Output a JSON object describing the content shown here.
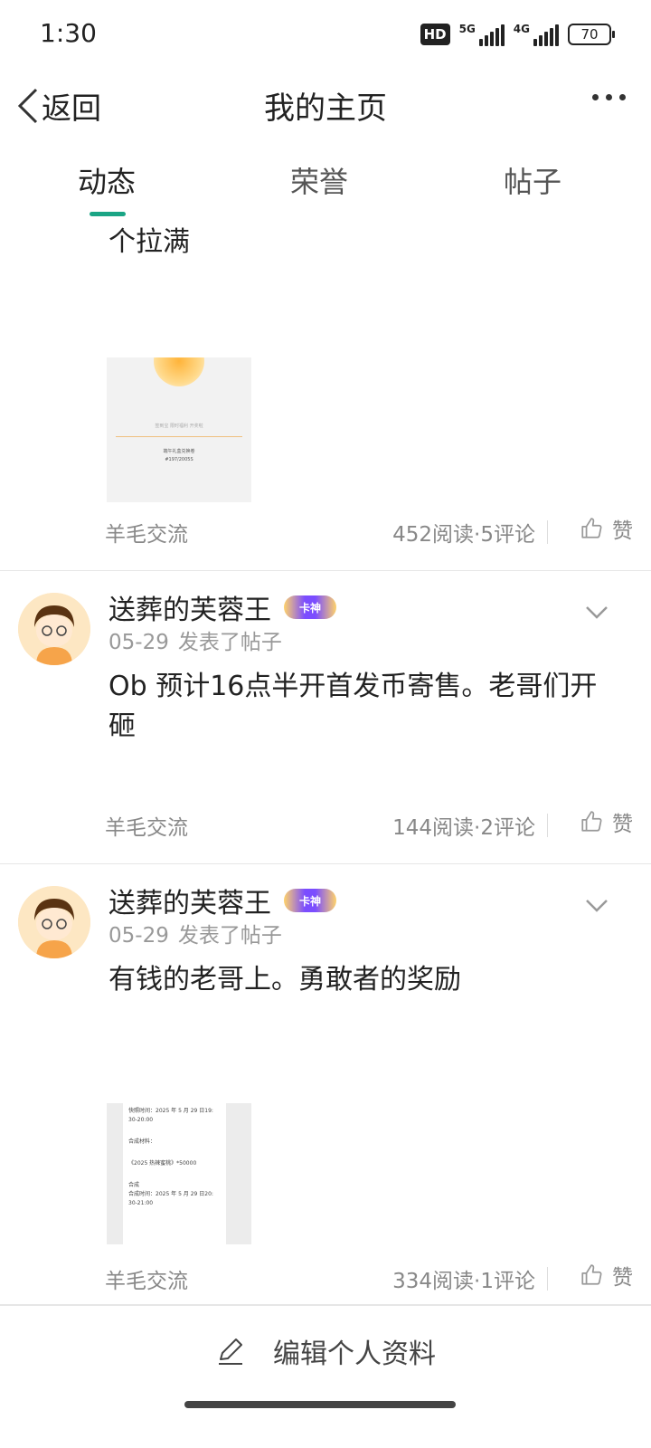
{
  "status_bar": {
    "time": "1:30",
    "hd": "HD",
    "net1": "5G",
    "net2": "4G",
    "battery": "70"
  },
  "header": {
    "back_label": "返回",
    "title": "我的主页",
    "more_icon": "more-dots-icon"
  },
  "tabs": [
    {
      "label": "动态",
      "active": true
    },
    {
      "label": "荣誉",
      "active": false
    },
    {
      "label": "帖子",
      "active": false
    }
  ],
  "colors": {
    "accent": "#1aa585",
    "muted": "#888888"
  },
  "posts": [
    {
      "text": "个拉满",
      "thumb_lines": [
        "签到宝 限时福利 开奖啦",
        "端午礼盒兑换卷",
        "#197/2005S"
      ],
      "forum": "羊毛交流",
      "stats": "452阅读·5评论",
      "like_label": "赞"
    },
    {
      "username": "送葬的芙蓉王",
      "badge": "卡神",
      "date": "05-29",
      "action": "发表了帖子",
      "text": "Ob 预计16点半开首发币寄售。老哥们开砸",
      "forum": "羊毛交流",
      "stats": "144阅读·2评论",
      "like_label": "赞"
    },
    {
      "username": "送葬的芙蓉王",
      "badge": "卡神",
      "date": "05-29",
      "action": "发表了帖子",
      "text": "有钱的老哥上。勇敢者的奖励",
      "thumb_lines": [
        "快照时间：2025 年 5 月 29 日19:",
        "30-20:00",
        "合成材料：",
        "《2025 热辣蜜桃》*50000",
        "合成",
        "合成时间：2025 年 5 月 29 日20:",
        "30-21:00"
      ],
      "forum": "羊毛交流",
      "stats": "334阅读·1评论",
      "like_label": "赞"
    }
  ],
  "bottom_bar": {
    "edit_label": "编辑个人资料"
  }
}
